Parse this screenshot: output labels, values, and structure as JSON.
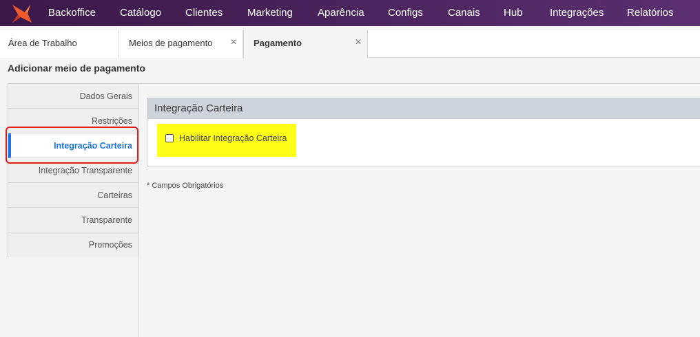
{
  "nav": {
    "items": [
      {
        "label": "Backoffice"
      },
      {
        "label": "Catálogo"
      },
      {
        "label": "Clientes"
      },
      {
        "label": "Marketing"
      },
      {
        "label": "Aparência"
      },
      {
        "label": "Configs"
      },
      {
        "label": "Canais"
      },
      {
        "label": "Hub"
      },
      {
        "label": "Integrações"
      },
      {
        "label": "Relatórios"
      }
    ]
  },
  "tabs": [
    {
      "label": "Área de Trabalho"
    },
    {
      "label": "Meios de pagamento",
      "close": "×"
    },
    {
      "label": "Pagamento",
      "close": "×"
    }
  ],
  "page": {
    "title": "Adicionar meio de pagamento"
  },
  "sidebar": {
    "items": [
      {
        "label": "Dados Gerais"
      },
      {
        "label": "Restrições"
      },
      {
        "label": "Integração Carteira"
      },
      {
        "label": "Integração Transparente"
      },
      {
        "label": "Carteiras"
      },
      {
        "label": "Transparente"
      },
      {
        "label": "Promoções"
      }
    ]
  },
  "panel": {
    "title": "Integração Carteira",
    "checkbox_label": "Habilitar Integração Carteira"
  },
  "footnote": "* Campos Obrigatórios",
  "colors": {
    "nav_bg": "#4a2460",
    "active_blue": "#1a73e8",
    "highlight_yellow": "#ffff1a",
    "annotation_red": "#e02020"
  }
}
